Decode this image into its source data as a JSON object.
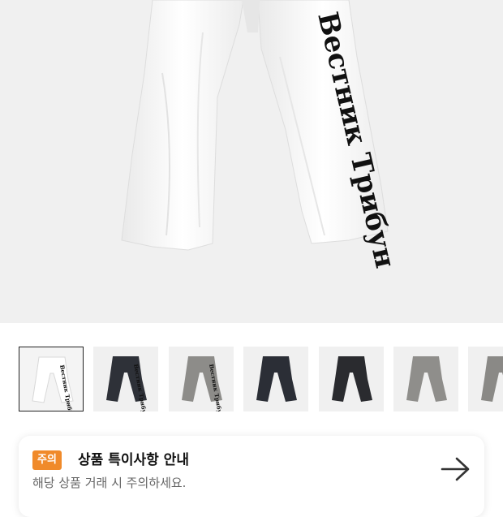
{
  "hero": {
    "image_label": "product-photo-white-sweatpants",
    "print_text": "Вестник Трибун"
  },
  "thumbnails": [
    {
      "color": "#ffffff",
      "print": "Вестник Трибун",
      "selected": true
    },
    {
      "color": "#2e3138",
      "print": "Вестник Трибун",
      "selected": false
    },
    {
      "color": "#8d8c89",
      "print": "Вестник Трибун",
      "selected": false
    },
    {
      "color": "#2b2e36",
      "print": "",
      "selected": false
    },
    {
      "color": "#2a2b2f",
      "print": "",
      "selected": false
    },
    {
      "color": "#8f8e8b",
      "print": "",
      "selected": false
    },
    {
      "color": "#8a8986",
      "print": "",
      "selected": false
    }
  ],
  "notice": {
    "badge": "주의",
    "title": "상품 특이사항 안내",
    "subtitle": "해당 상품 거래 시 주의하세요.",
    "arrow_icon": "arrow-right-icon"
  },
  "colors": {
    "badge": "#f08a2a",
    "hero_bg": "#f0f0f0"
  }
}
